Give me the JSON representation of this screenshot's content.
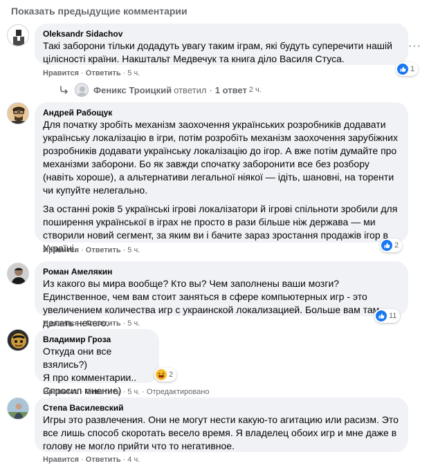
{
  "prev_comments_label": "Показать предыдущие комментарии",
  "actions": {
    "like": "Нравится",
    "reply": "Ответить",
    "sep": "·"
  },
  "comments": [
    {
      "author": "Oleksandr Sidachov",
      "paragraphs": [
        "Такі заборони тільки додадуть увагу таким іграм, які будуть суперечити нашій цілісності країни. Накштальт Медвечук та книга діло Василя Стуса."
      ],
      "time": "5 ч.",
      "reactions": "1"
    },
    {
      "author": "Андрей Рабощук",
      "paragraphs": [
        "Для початку зробіть механізм заохочення українських розробників додавати українську локалізацію в ігри, потім розробіть механізм заохочення зарубіжних розробників додавати українську локалізацію до ігор. А вже потім думайте про механізми заборони. Бо як завжди спочатку заборонити все без розбору (навіть хороше), а альтернативи легальної ніякої — ідіть, шановні, на торенти чи купуйте нелегально.",
        "За останні років 5 українські ігрові локалізатори й ігрові спільноти зробили для поширення української в іграх не просто в рази більше ніж держава — ми створили новий сегмент, за яким ви і бачите зараз зростання продажів ігор в Україні."
      ],
      "time": "5 ч.",
      "reactions": "2"
    },
    {
      "author": "Роман Амелякин",
      "paragraphs": [
        "Из какого вы мира вообще? Кто вы? Чем заполнены ваши мозги? Единственное, чем вам стоит заняться в сфере компьютерных игр - это увеличением количества игр с украинской локализацией. Больше вам там делать нечего."
      ],
      "time": "5 ч.",
      "reactions": "11"
    },
    {
      "author": "Владимир Гроза",
      "paragraphs": [
        "Откуда они все взялись?)\nЯ про комментарии..\nСпросил мнение)"
      ],
      "time": "5 ч.",
      "edited": "Отредактировано",
      "reactions": "2"
    },
    {
      "author": "Степа Василевский",
      "paragraphs": [
        "Игры это развлечения. Они не могут нести какую-то агитацию или расизм. Это все лишь способ скоротать весело время. Я владелец обоих игр и мне даже в голову не могло прийти что то негативное."
      ],
      "time": "4 ч."
    }
  ],
  "reply_summary": {
    "name": "Феникс Троицкий",
    "verb": "ответил",
    "sep": "·",
    "count": "1 ответ",
    "time": "2 ч."
  },
  "more_glyph": "···",
  "colors": {
    "bubble": "#f0f2f5",
    "muted": "#65676b",
    "like_blue": "#1877f2",
    "haha_yellow": "#f7b928"
  },
  "icons": {
    "like": "like-icon",
    "haha": "haha-icon",
    "reply_arrow": "reply-arrow-icon",
    "more": "more-options-icon"
  }
}
